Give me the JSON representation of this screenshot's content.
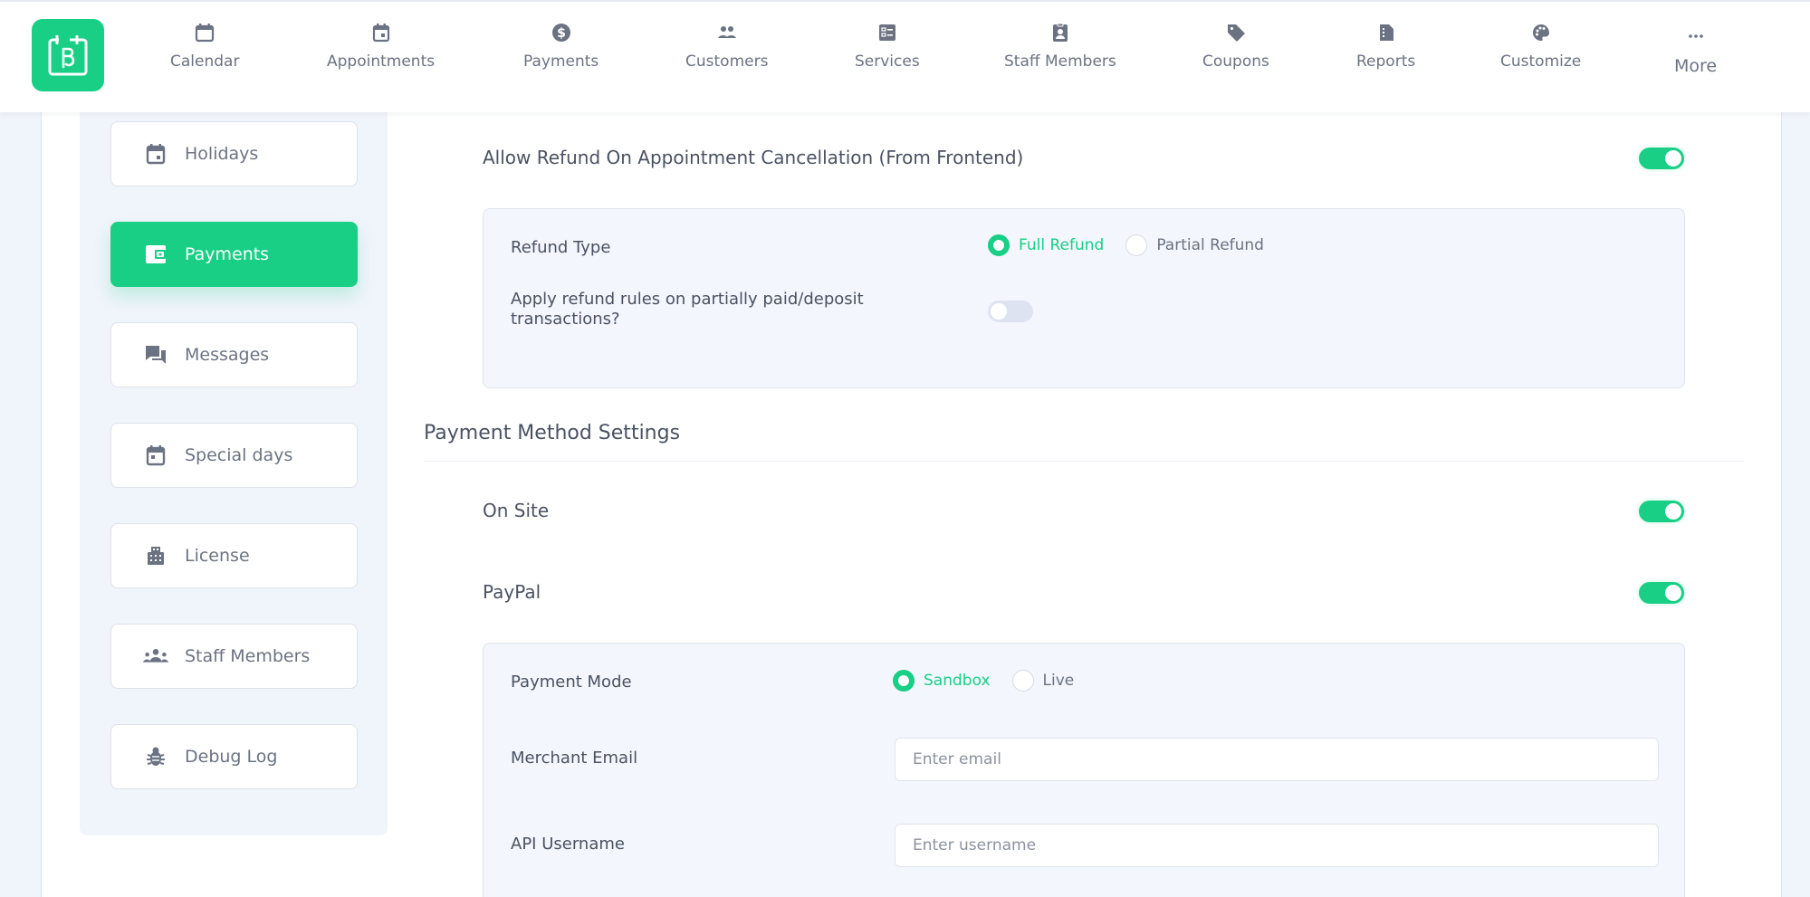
{
  "app": {
    "logo_icon": "booknetic-calendar-logo-icon",
    "brand_color": "#18cf85"
  },
  "nav": {
    "items": [
      {
        "label": "Calendar",
        "icon": "calendar-icon"
      },
      {
        "label": "Appointments",
        "icon": "calendar-event-icon"
      },
      {
        "label": "Payments",
        "icon": "dollar-circle-icon"
      },
      {
        "label": "Customers",
        "icon": "users-icon"
      },
      {
        "label": "Services",
        "icon": "list-box-icon"
      },
      {
        "label": "Staff Members",
        "icon": "id-badge-icon"
      },
      {
        "label": "Coupons",
        "icon": "tag-icon"
      },
      {
        "label": "Reports",
        "icon": "report-file-icon"
      },
      {
        "label": "Customize",
        "icon": "palette-icon"
      },
      {
        "label": "More",
        "icon": "ellipsis-icon"
      }
    ]
  },
  "sidebar": {
    "items": [
      {
        "label": "Holidays",
        "icon": "calendar-event-icon",
        "active": false
      },
      {
        "label": "Payments",
        "icon": "wallet-icon",
        "active": true
      },
      {
        "label": "Messages",
        "icon": "chat-bubbles-icon",
        "active": false
      },
      {
        "label": "Special days",
        "icon": "calendar-day-icon",
        "active": false
      },
      {
        "label": "License",
        "icon": "building-icon",
        "active": false
      },
      {
        "label": "Staff Members",
        "icon": "team-icon",
        "active": false
      },
      {
        "label": "Debug Log",
        "icon": "bug-icon",
        "active": false
      }
    ]
  },
  "refund": {
    "allow_label": "Allow Refund On Appointment Cancellation (From Frontend)",
    "allow_enabled": true,
    "type_label": "Refund Type",
    "type_options": [
      "Full Refund",
      "Partial Refund"
    ],
    "type_selected": "Full Refund",
    "partial_label": "Apply refund rules on partially paid/deposit transactions?",
    "partial_enabled": false
  },
  "payment_methods": {
    "section_title": "Payment Method Settings",
    "on_site": {
      "label": "On Site",
      "enabled": true
    },
    "paypal": {
      "label": "PayPal",
      "enabled": true,
      "mode_label": "Payment Mode",
      "mode_options": [
        "Sandbox",
        "Live"
      ],
      "mode_selected": "Sandbox",
      "merchant_email_label": "Merchant Email",
      "merchant_email_placeholder": "Enter email",
      "merchant_email_value": "",
      "api_username_label": "API Username",
      "api_username_placeholder": "Enter username",
      "api_username_value": ""
    }
  }
}
